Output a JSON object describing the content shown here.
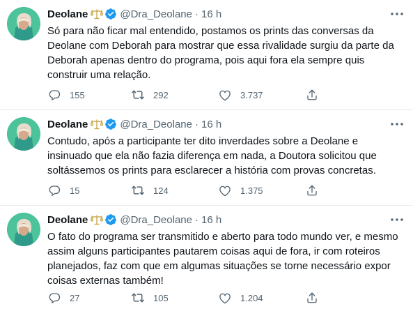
{
  "colors": {
    "verified": "#1d9bf0",
    "secondary_text": "#536471",
    "badge": "#c8a84b",
    "divider": "#e6ecf0"
  },
  "tweets": [
    {
      "name": "Deolane",
      "handle": "@Dra_Deolane",
      "separator": "·",
      "time": "16 h",
      "text": "Só para não ficar mal entendido, postamos os prints das conversas da\nDeolane com Deborah para mostrar que essa rivalidade surgiu da parte da\nDeborah apenas dentro do programa, pois aqui fora ela sempre quis\nconstruir uma relação.",
      "replies": "155",
      "retweets": "292",
      "likes": "3.737"
    },
    {
      "name": "Deolane",
      "handle": "@Dra_Deolane",
      "separator": "·",
      "time": "16 h",
      "text": "Contudo, após a participante ter dito inverdades sobre a Deolane e\ninsinuado que ela não fazia diferença em nada, a Doutora solicitou que\nsoltássemos os prints para esclarecer a história com provas concretas.",
      "replies": "15",
      "retweets": "124",
      "likes": "1.375"
    },
    {
      "name": "Deolane",
      "handle": "@Dra_Deolane",
      "separator": "·",
      "time": "16 h",
      "text": "O fato do programa ser transmitido e aberto para todo mundo ver, e mesmo\nassim alguns participantes pautarem coisas aqui de fora, ir com roteiros\nplanejados, faz com que em algumas situações se torne necessário expor\ncoisas externas também!",
      "replies": "27",
      "retweets": "105",
      "likes": "1.204"
    }
  ],
  "icons": {
    "more": "more-icon",
    "reply": "reply-icon",
    "retweet": "retweet-icon",
    "like": "like-icon",
    "share": "share-icon",
    "verified": "verified-badge-icon",
    "scale": "scales-of-justice-icon"
  }
}
